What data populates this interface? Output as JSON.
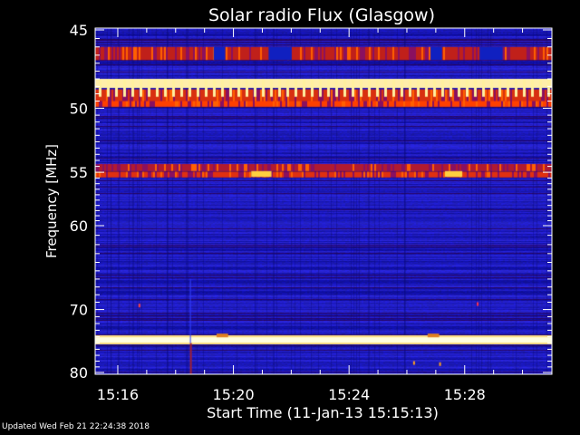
{
  "chart_data": {
    "type": "heatmap",
    "title": "Solar radio Flux (Glasgow)",
    "xlabel": "Start Time (11-Jan-13 15:15:13)",
    "ylabel": "Frequency [MHz]",
    "ylim": [
      45,
      80
    ],
    "y_inverted": true,
    "x_range": [
      "15:15:13",
      "15:31:00"
    ],
    "x_ticks": [
      "15:16",
      "15:20",
      "15:24",
      "15:28"
    ],
    "x_tick_values_min": [
      0.783,
      4.783,
      8.783,
      12.783
    ],
    "x_range_min": [
      0,
      15.8
    ],
    "y_ticks": [
      "45",
      "50",
      "55",
      "60",
      "70",
      "80"
    ],
    "y_tick_values": [
      45,
      50,
      55,
      60,
      70,
      80
    ],
    "y_minor_ticks": [
      45.5,
      46,
      46.5,
      47,
      47.5,
      48,
      48.5,
      49,
      49.5,
      50.5,
      51,
      51.5,
      52,
      52.5,
      53,
      53.5,
      54,
      54.5,
      55.5,
      56,
      56.5,
      57,
      57.5,
      58,
      58.5,
      59,
      59.5,
      61,
      62,
      63,
      64,
      65,
      66,
      67,
      68,
      69,
      71,
      72,
      73,
      74,
      75,
      76,
      77,
      78,
      79
    ],
    "x_minor_ticks_min": [
      1.783,
      2.783,
      3.783,
      5.783,
      6.783,
      7.783,
      9.783,
      10.783,
      11.783,
      13.783,
      14.783
    ],
    "bands": [
      {
        "freq": 46.4,
        "width": 0.8,
        "level": "strong",
        "color": "#c0201a"
      },
      {
        "freq": 48.3,
        "width": 0.6,
        "level": "very-strong",
        "color": "#ffeeaa"
      },
      {
        "freq": 49.2,
        "width": 1.0,
        "level": "strong",
        "color": "#d83010"
      },
      {
        "freq": 49.7,
        "width": 0.4,
        "level": "strong",
        "color": "#ff4000"
      },
      {
        "freq": 54.6,
        "width": 0.6,
        "level": "strong",
        "color": "#b01a30"
      },
      {
        "freq": 55.2,
        "width": 0.5,
        "level": "strong",
        "color": "#e03010"
      },
      {
        "freq": 74.5,
        "width": 1.3,
        "level": "saturated",
        "color": "#fff8d0"
      }
    ],
    "colors": {
      "background": "#000000",
      "plot_base": "#1a1adc",
      "plot_dark": "#0a0a78",
      "axis": "#ffffff"
    }
  },
  "footer": {
    "updated": "Updated Wed Feb 21 22:24:38 2018"
  }
}
